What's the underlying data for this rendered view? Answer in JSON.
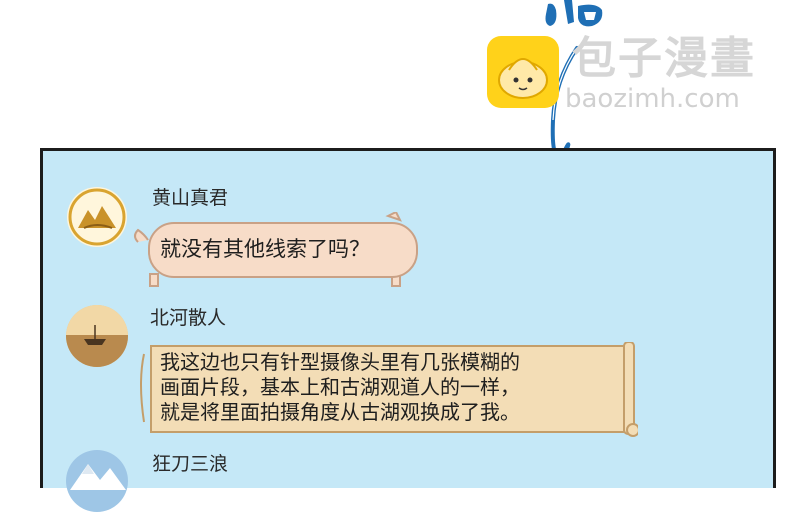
{
  "watermark": {
    "title": "包子漫畫",
    "url": "baozimh.com",
    "logo_icon": "bun-mascot-icon"
  },
  "colors": {
    "panel_bg": "#c5e8f7",
    "bubble_pink": "#f7dcc8",
    "scroll_tan": "#f3ddb6",
    "sfx_blue": "#1f6fb5"
  },
  "chat": {
    "messages": [
      {
        "sender": "黄山真君",
        "avatar_icon": "mountain-avatar-icon",
        "text": "就没有其他线索了吗？"
      },
      {
        "sender": "北河散人",
        "avatar_icon": "sunset-lake-avatar-icon",
        "lines": [
          "我这边也只有针型摄像头里有几张模糊的",
          "画面片段，基本上和古湖观道人的一样，",
          "就是将里面拍摄角度从古湖观换成了我。"
        ]
      },
      {
        "sender": "狂刀三浪",
        "avatar_icon": "mountain-sky-avatar-icon"
      }
    ]
  }
}
